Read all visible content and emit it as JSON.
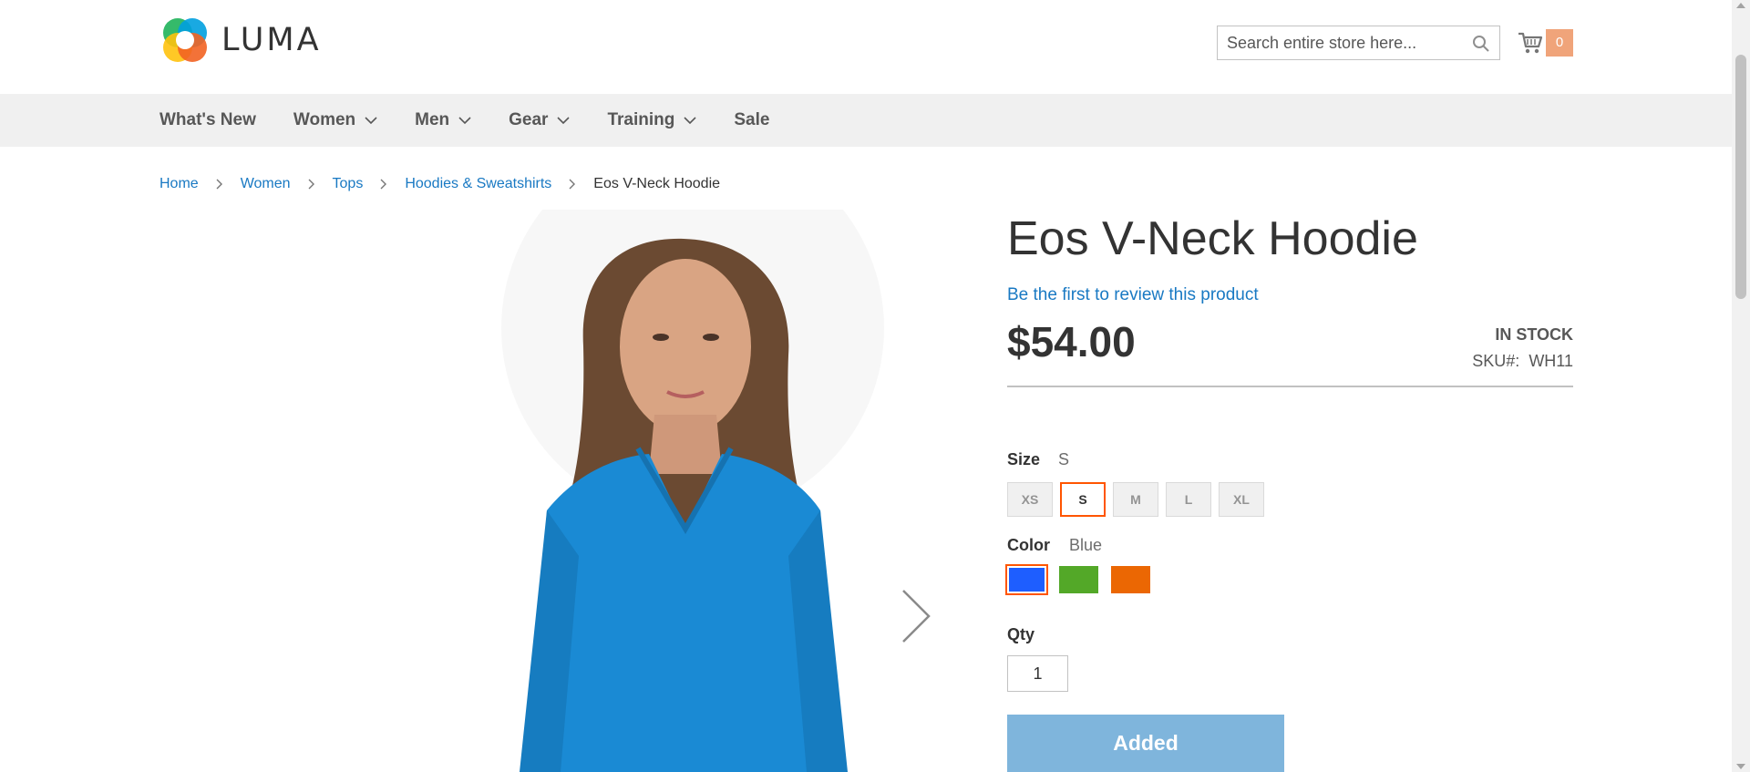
{
  "header": {
    "logo_text": "LUMA",
    "search_placeholder": "Search entire store here...",
    "cart_count": "0"
  },
  "nav": {
    "items": [
      {
        "label": "What's New",
        "has_submenu": false
      },
      {
        "label": "Women",
        "has_submenu": true
      },
      {
        "label": "Men",
        "has_submenu": true
      },
      {
        "label": "Gear",
        "has_submenu": true
      },
      {
        "label": "Training",
        "has_submenu": true
      },
      {
        "label": "Sale",
        "has_submenu": false
      }
    ]
  },
  "breadcrumb": {
    "links": [
      "Home",
      "Women",
      "Tops",
      "Hoodies & Sweatshirts"
    ],
    "current": "Eos V-Neck Hoodie"
  },
  "product": {
    "title": "Eos V-Neck Hoodie",
    "review_link": "Be the first to review this product",
    "price": "$54.00",
    "stock": "IN STOCK",
    "sku_label": "SKU#:",
    "sku_value": "WH11",
    "size_label": "Size",
    "size_selected": "S",
    "sizes": [
      "XS",
      "S",
      "M",
      "L",
      "XL"
    ],
    "color_label": "Color",
    "color_selected": "Blue",
    "colors": [
      {
        "name": "Blue",
        "hex": "#1e5eff"
      },
      {
        "name": "Green",
        "hex": "#53a828"
      },
      {
        "name": "Orange",
        "hex": "#eb6703"
      }
    ],
    "qty_label": "Qty",
    "qty_value": "1",
    "add_button_label": "Added"
  },
  "colors": {
    "link": "#1979c3",
    "accent": "#ff5501",
    "nav_bg": "#f0f0f0",
    "button_bg": "#7fb5dc",
    "cart_badge": "#f0a47a",
    "hoodie": "#1a8ad4"
  }
}
